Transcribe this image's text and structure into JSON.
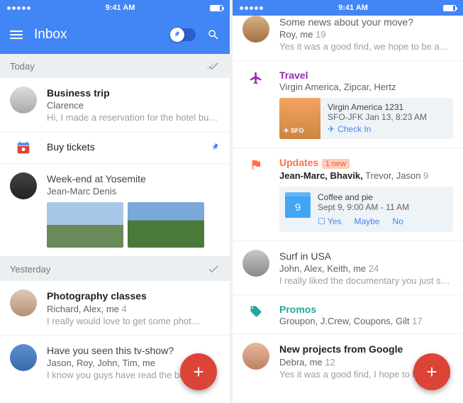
{
  "status": {
    "time": "9:41 AM"
  },
  "appbar": {
    "title": "Inbox"
  },
  "sections": {
    "today": "Today",
    "yesterday": "Yesterday"
  },
  "left": {
    "msg1": {
      "subject": "Business trip",
      "people": "Clarence",
      "snippet": "Hi, I made a reservation for the hotel but it…"
    },
    "reminder": {
      "text": "Buy tickets"
    },
    "msg2": {
      "subject": "Week-end at Yosemite",
      "people": "Jean-Marc Denis"
    },
    "msg3": {
      "subject": "Photography classes",
      "people": "Richard, Alex, me",
      "count": "4",
      "snippet": "I really would love to get some phot…"
    },
    "msg4": {
      "subject": "Have you seen this tv-show?",
      "people": "Jason, Roy, John, Tim, me",
      "snippet": "I know you guys have read the book an…"
    }
  },
  "right": {
    "msg0": {
      "subject": "Some news about your move?",
      "people": "Roy, me",
      "count": "19",
      "snippet": "Yes it was a good find, we hope to be able …"
    },
    "travel": {
      "title": "Travel",
      "people": "Virgin America, Zipcar, Hertz",
      "card": {
        "title": "Virgin America 1231",
        "route": "SFO-JFK Jan 13, 8:23 AM",
        "action": "Check In",
        "tag": "SFO"
      }
    },
    "updates": {
      "title": "Updates",
      "badge": "1 new",
      "people_bold": "Jean-Marc, Bhavik,",
      "people_rest": " Trevor, Jason",
      "count": "9",
      "event": {
        "title": "Coffee and pie",
        "when": "Sept 9, 9:00 AM - 11 AM",
        "day": "9",
        "yes": "Yes",
        "maybe": "Maybe",
        "no": "No"
      }
    },
    "msg1": {
      "subject": "Surf in USA",
      "people": "John, Alex, Keith, me",
      "count": "24",
      "snippet": "I really liked the documentary you just sent…"
    },
    "promos": {
      "title": "Promos",
      "people": "Groupon, J.Crew, Coupons, Gilt",
      "count": "17"
    },
    "msg2": {
      "subject": "New projects from Google",
      "people": "Debra, me",
      "count": "12",
      "snippet": "Yes it was a good find, I hope to be able …"
    }
  }
}
